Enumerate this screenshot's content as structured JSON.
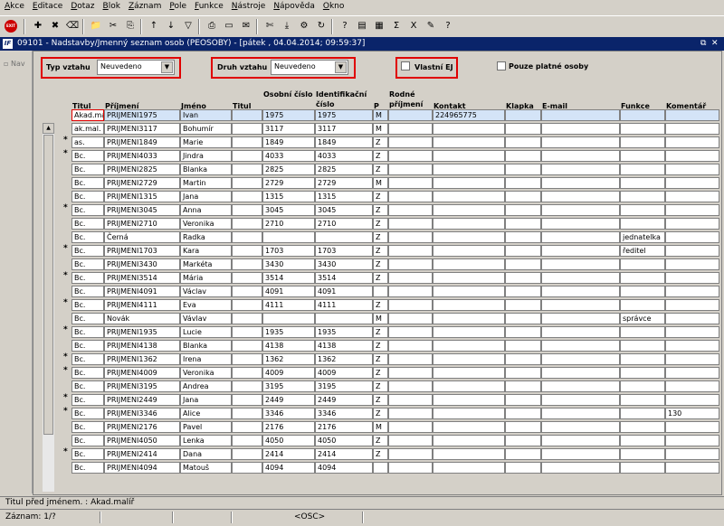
{
  "menu": [
    "Akce",
    "Editace",
    "Dotaz",
    "Blok",
    "Záznam",
    "Pole",
    "Funkce",
    "Nástroje",
    "Nápověda",
    "Okno"
  ],
  "toolbar": {
    "exit_label": "EXIT",
    "icons": [
      "new-record-icon",
      "delete-record-icon",
      "clear-icon",
      "save-icon",
      "cut-icon",
      "copy-icon",
      "sort-asc-icon",
      "sort-desc-icon",
      "filter-icon",
      "print-icon",
      "preview-icon",
      "mail-icon",
      "scissors-icon",
      "export-icon",
      "settings-icon",
      "refresh-icon",
      "query-icon",
      "chart-icon",
      "calendar-icon",
      "sum-icon",
      "excel-icon",
      "edit-icon",
      "help-icon"
    ]
  },
  "window": {
    "logo": "IF",
    "title": "09101 - Nadstavby/Jmenný seznam osob (PEOSOBY) - [pátek , 04.04.2014; 09:59:37]",
    "controls": [
      "⧉",
      "✕"
    ]
  },
  "nav": {
    "label": "Nav"
  },
  "filters": {
    "typ_label": "Typ vztahu",
    "typ_value": "Neuvedeno",
    "druh_label": "Druh vztahu",
    "druh_value": "Neuvedeno",
    "vlastni_label": "Vlastní EJ",
    "platne_label": "Pouze platné osoby"
  },
  "columns": [
    {
      "key": "titul",
      "label": "Titul"
    },
    {
      "key": "prijmeni",
      "label": "Příjmení"
    },
    {
      "key": "jmeno",
      "label": "Jméno"
    },
    {
      "key": "titul2",
      "label": "Titul"
    },
    {
      "key": "oc",
      "label": "Osobní číslo"
    },
    {
      "key": "ic",
      "label": "Identifikační číslo"
    },
    {
      "key": "p",
      "label": "P"
    },
    {
      "key": "rp",
      "label": "Rodné příjmení"
    },
    {
      "key": "kontakt",
      "label": "Kontakt"
    },
    {
      "key": "klapka",
      "label": "Klapka"
    },
    {
      "key": "email",
      "label": "E-mail"
    },
    {
      "key": "funkce",
      "label": "Funkce"
    },
    {
      "key": "komentar",
      "label": "Komentář"
    }
  ],
  "rows": [
    {
      "star": "",
      "titul": "Akad.mal",
      "prijmeni": "PRIJMENI1975",
      "jmeno": "Ivan",
      "oc": "1975",
      "ic": "1975",
      "p": "M",
      "kontakt": "224965775",
      "funkce": "",
      "komentar": ""
    },
    {
      "star": "",
      "titul": "ak.mal.",
      "prijmeni": "PRIJMENI3117",
      "jmeno": "Bohumír",
      "oc": "3117",
      "ic": "3117",
      "p": "M",
      "kontakt": "",
      "funkce": "",
      "komentar": ""
    },
    {
      "star": "*",
      "titul": "as.",
      "prijmeni": "PRIJMENI1849",
      "jmeno": "Marie",
      "oc": "1849",
      "ic": "1849",
      "p": "Z",
      "kontakt": "",
      "funkce": "",
      "komentar": ""
    },
    {
      "star": "*",
      "titul": "Bc.",
      "prijmeni": "PRIJMENI4033",
      "jmeno": "Jindra",
      "oc": "4033",
      "ic": "4033",
      "p": "Z",
      "kontakt": "",
      "funkce": "",
      "komentar": ""
    },
    {
      "star": "",
      "titul": "Bc.",
      "prijmeni": "PRIJMENI2825",
      "jmeno": "Blanka",
      "oc": "2825",
      "ic": "2825",
      "p": "Z",
      "kontakt": "",
      "funkce": "",
      "komentar": ""
    },
    {
      "star": "",
      "titul": "Bc.",
      "prijmeni": "PRIJMENI2729",
      "jmeno": "Martin",
      "oc": "2729",
      "ic": "2729",
      "p": "M",
      "kontakt": "",
      "funkce": "",
      "komentar": ""
    },
    {
      "star": "",
      "titul": "Bc.",
      "prijmeni": "PRIJMENI1315",
      "jmeno": "Jana",
      "oc": "1315",
      "ic": "1315",
      "p": "Z",
      "kontakt": "",
      "funkce": "",
      "komentar": ""
    },
    {
      "star": "*",
      "titul": "Bc.",
      "prijmeni": "PRIJMENI3045",
      "jmeno": "Anna",
      "oc": "3045",
      "ic": "3045",
      "p": "Z",
      "kontakt": "",
      "funkce": "",
      "komentar": ""
    },
    {
      "star": "",
      "titul": "Bc.",
      "prijmeni": "PRIJMENI2710",
      "jmeno": "Veronika",
      "oc": "2710",
      "ic": "2710",
      "p": "Z",
      "kontakt": "",
      "funkce": "",
      "komentar": ""
    },
    {
      "star": "",
      "titul": "Bc.",
      "prijmeni": "Černá",
      "jmeno": "Radka",
      "oc": "",
      "ic": "",
      "p": "Z",
      "kontakt": "",
      "funkce": "jednatelka",
      "komentar": ""
    },
    {
      "star": "*",
      "titul": "Bc.",
      "prijmeni": "PRIJMENI1703",
      "jmeno": "Kara",
      "oc": "1703",
      "ic": "1703",
      "p": "Z",
      "kontakt": "",
      "funkce": "ředitel",
      "komentar": ""
    },
    {
      "star": "",
      "titul": "Bc.",
      "prijmeni": "PRIJMENI3430",
      "jmeno": "Markéta",
      "oc": "3430",
      "ic": "3430",
      "p": "Z",
      "kontakt": "",
      "funkce": "",
      "komentar": ""
    },
    {
      "star": "*",
      "titul": "Bc.",
      "prijmeni": "PRIJMENI3514",
      "jmeno": "Mária",
      "oc": "3514",
      "ic": "3514",
      "p": "Z",
      "kontakt": "",
      "funkce": "",
      "komentar": ""
    },
    {
      "star": "",
      "titul": "Bc.",
      "prijmeni": "PRIJMENI4091",
      "jmeno": "Václav",
      "oc": "4091",
      "ic": "4091",
      "p": "",
      "kontakt": "",
      "funkce": "",
      "komentar": ""
    },
    {
      "star": "*",
      "titul": "Bc.",
      "prijmeni": "PRIJMENI4111",
      "jmeno": "Eva",
      "oc": "4111",
      "ic": "4111",
      "p": "Z",
      "kontakt": "",
      "funkce": "",
      "komentar": ""
    },
    {
      "star": "",
      "titul": "Bc.",
      "prijmeni": "Novák",
      "jmeno": "Vávlav",
      "oc": "",
      "ic": "",
      "p": "M",
      "kontakt": "",
      "funkce": "správce",
      "komentar": ""
    },
    {
      "star": "*",
      "titul": "Bc.",
      "prijmeni": "PRIJMENI1935",
      "jmeno": "Lucie",
      "oc": "1935",
      "ic": "1935",
      "p": "Z",
      "kontakt": "",
      "funkce": "",
      "komentar": ""
    },
    {
      "star": "",
      "titul": "Bc.",
      "prijmeni": "PRIJMENI4138",
      "jmeno": "Blanka",
      "oc": "4138",
      "ic": "4138",
      "p": "Z",
      "kontakt": "",
      "funkce": "",
      "komentar": ""
    },
    {
      "star": "*",
      "titul": "Bc.",
      "prijmeni": "PRIJMENI1362",
      "jmeno": "Irena",
      "oc": "1362",
      "ic": "1362",
      "p": "Z",
      "kontakt": "",
      "funkce": "",
      "komentar": ""
    },
    {
      "star": "*",
      "titul": "Bc.",
      "prijmeni": "PRIJMENI4009",
      "jmeno": "Veronika",
      "oc": "4009",
      "ic": "4009",
      "p": "Z",
      "kontakt": "",
      "funkce": "",
      "komentar": ""
    },
    {
      "star": "",
      "titul": "Bc.",
      "prijmeni": "PRIJMENI3195",
      "jmeno": "Andrea",
      "oc": "3195",
      "ic": "3195",
      "p": "Z",
      "kontakt": "",
      "funkce": "",
      "komentar": ""
    },
    {
      "star": "*",
      "titul": "Bc.",
      "prijmeni": "PRIJMENI2449",
      "jmeno": "Jana",
      "oc": "2449",
      "ic": "2449",
      "p": "Z",
      "kontakt": "",
      "funkce": "",
      "komentar": ""
    },
    {
      "star": "*",
      "titul": "Bc.",
      "prijmeni": "PRIJMENI3346",
      "jmeno": "Alice",
      "oc": "3346",
      "ic": "3346",
      "p": "Z",
      "kontakt": "",
      "funkce": "",
      "komentar": "130"
    },
    {
      "star": "",
      "titul": "Bc.",
      "prijmeni": "PRIJMENI2176",
      "jmeno": "Pavel",
      "oc": "2176",
      "ic": "2176",
      "p": "M",
      "kontakt": "",
      "funkce": "",
      "komentar": ""
    },
    {
      "star": "",
      "titul": "Bc.",
      "prijmeni": "PRIJMENI4050",
      "jmeno": "Lenka",
      "oc": "4050",
      "ic": "4050",
      "p": "Z",
      "kontakt": "",
      "funkce": "",
      "komentar": ""
    },
    {
      "star": "*",
      "titul": "Bc.",
      "prijmeni": "PRIJMENI2414",
      "jmeno": "Dana",
      "oc": "2414",
      "ic": "2414",
      "p": "Z",
      "kontakt": "",
      "funkce": "",
      "komentar": ""
    },
    {
      "star": "",
      "titul": "Bc.",
      "prijmeni": "PRIJMENI4094",
      "jmeno": "Matouš",
      "oc": "4094",
      "ic": "4094",
      "p": "",
      "kontakt": "",
      "funkce": "",
      "komentar": ""
    }
  ],
  "hint": "Titul před jménem. : Akad.malíř",
  "status": {
    "record": "Záznam: 1/?",
    "mode": "<OSC>"
  }
}
